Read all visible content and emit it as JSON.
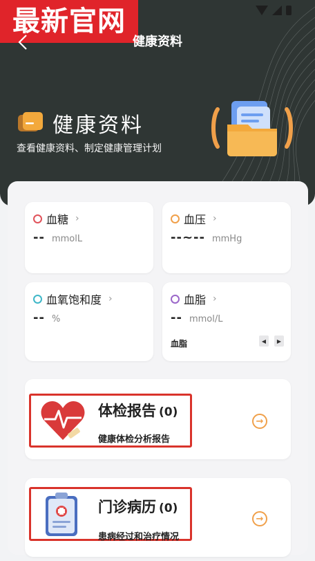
{
  "watermark": "最新官网",
  "nav": {
    "title": "健康资料"
  },
  "hero": {
    "title": "健康资料",
    "subtitle": "查看健康资料、制定健康管理计划"
  },
  "metrics": [
    {
      "label": "血糖",
      "value": "--",
      "unit": "mmolL",
      "color": "#e0525a"
    },
    {
      "label": "血压",
      "value": "--~--",
      "unit": "mmHg",
      "color": "#f0a04a"
    },
    {
      "label": "血氧饱和度",
      "value": "--",
      "unit": "%",
      "color": "#3fb7c8"
    },
    {
      "label": "血脂",
      "value": "--",
      "unit": "mmol/L",
      "color": "#9b67c9",
      "extra": "血脂"
    }
  ],
  "entries": [
    {
      "title": "体检报告",
      "count": "(0)",
      "subtitle": "健康体检分析报告"
    },
    {
      "title": "门诊病历",
      "count": "(0)",
      "subtitle": "患病经过和治疗情况"
    }
  ],
  "icons": {
    "chevron": "›",
    "arrow": "→",
    "pager_prev": "◀",
    "pager_next": "▶"
  },
  "colors": {
    "header": "#2f3634",
    "accent": "#f0a04a",
    "highlight": "#d9332b",
    "watermark": "#e0242a"
  }
}
